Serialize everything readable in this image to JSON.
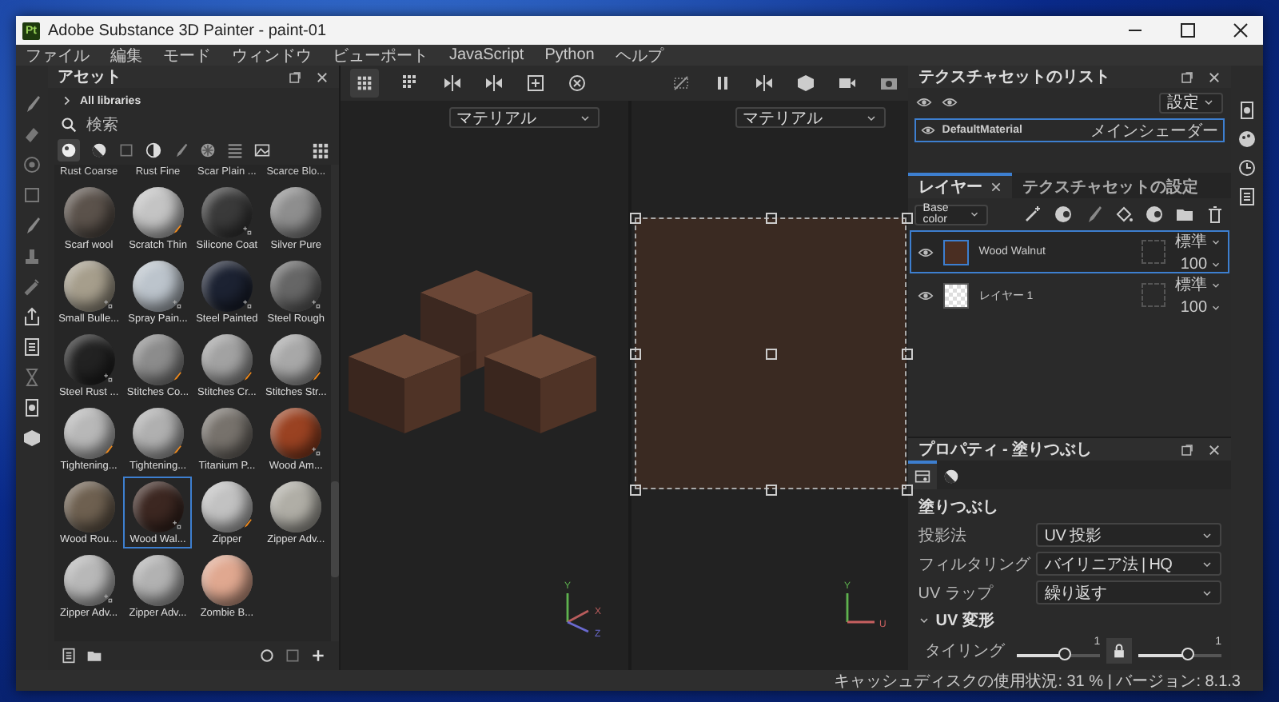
{
  "window": {
    "app_badge": "Pt",
    "title": "Adobe Substance 3D Painter - paint-01"
  },
  "menu": [
    "ファイル",
    "編集",
    "モード",
    "ウィンドウ",
    "ビューポート",
    "JavaScript",
    "Python",
    "ヘルプ"
  ],
  "assets": {
    "title": "アセット",
    "library": "All libraries",
    "search": {
      "placeholder": "検索"
    },
    "partial_labels": [
      "Rust Coarse",
      "Rust Fine",
      "Scar Plain ...",
      "Scarce Blo..."
    ],
    "items": [
      {
        "name": "Scarf wool",
        "color": "#5b524b",
        "kind": "material",
        "selected": false
      },
      {
        "name": "Scratch Thin",
        "color": "#c4c4c4",
        "kind": "brush",
        "selected": false
      },
      {
        "name": "Silicone Coat",
        "color": "#3a3a3a",
        "kind": "preset",
        "selected": false
      },
      {
        "name": "Silver Pure",
        "color": "#8e8e8e",
        "kind": "material",
        "selected": false
      },
      {
        "name": "Small Bulle...",
        "color": "#a69e8c",
        "kind": "preset",
        "selected": false
      },
      {
        "name": "Spray Pain...",
        "color": "#bcc4cc",
        "kind": "preset",
        "selected": false
      },
      {
        "name": "Steel Painted",
        "color": "#1c2232",
        "kind": "preset",
        "selected": false
      },
      {
        "name": "Steel Rough",
        "color": "#666666",
        "kind": "preset",
        "selected": false
      },
      {
        "name": "Steel Rust ...",
        "color": "#222222",
        "kind": "preset",
        "selected": false
      },
      {
        "name": "Stitches Co...",
        "color": "#8c8c8c",
        "kind": "brush",
        "selected": false
      },
      {
        "name": "Stitches Cr...",
        "color": "#a2a2a2",
        "kind": "brush",
        "selected": false
      },
      {
        "name": "Stitches Str...",
        "color": "#a8a8a8",
        "kind": "brush",
        "selected": false
      },
      {
        "name": "Tightening...",
        "color": "#b8b8b8",
        "kind": "brush",
        "selected": false
      },
      {
        "name": "Tightening...",
        "color": "#b0b0b0",
        "kind": "brush",
        "selected": false
      },
      {
        "name": "Titanium P...",
        "color": "#77726c",
        "kind": "material",
        "selected": false
      },
      {
        "name": "Wood Am...",
        "color": "#9a4222",
        "kind": "preset",
        "selected": false
      },
      {
        "name": "Wood Rou...",
        "color": "#6e6050",
        "kind": "material",
        "selected": false
      },
      {
        "name": "Wood Wal...",
        "color": "#3c2721",
        "kind": "preset",
        "selected": true
      },
      {
        "name": "Zipper",
        "color": "#c2c2c2",
        "kind": "brush",
        "selected": false
      },
      {
        "name": "Zipper Adv...",
        "color": "#b0aea6",
        "kind": "material",
        "selected": false
      },
      {
        "name": "Zipper Adv...",
        "color": "#b8b8b8",
        "kind": "preset",
        "selected": false
      },
      {
        "name": "Zipper Adv...",
        "color": "#b2b2b2",
        "kind": "material",
        "selected": false
      },
      {
        "name": "Zombie B...",
        "color": "#e0a890",
        "kind": "material",
        "selected": false
      }
    ]
  },
  "viewport": {
    "panes": [
      {
        "kind": "model",
        "channel": "マテリアル",
        "axes": [
          {
            "label": "Y",
            "color": "#5fb34f"
          },
          {
            "label": "X",
            "color": "#b85c5c"
          },
          {
            "label": "Z",
            "color": "#6a6ad0"
          }
        ]
      },
      {
        "kind": "uv",
        "channel": "マテリアル",
        "axes": [
          {
            "label": "Y",
            "color": "#5fb34f"
          },
          {
            "label": "U",
            "color": "#c76060"
          }
        ]
      }
    ]
  },
  "texture_sets": {
    "title": "テクスチャセットのリスト",
    "settings": "設定",
    "items": [
      {
        "name": "DefaultMaterial",
        "shader": "メインシェーダー",
        "selected": true
      }
    ]
  },
  "layer_tabs": [
    {
      "label": "レイヤー",
      "selected": true,
      "closable": true
    },
    {
      "label": "テクスチャセットの設定",
      "selected": false,
      "closable": false
    }
  ],
  "channel": "Base color",
  "layers": [
    {
      "name": "Wood Walnut",
      "kind": "fill",
      "blend": "標準",
      "opacity": "100",
      "selected": true
    },
    {
      "name": "レイヤー 1",
      "kind": "paint",
      "blend": "標準",
      "opacity": "100",
      "selected": false
    }
  ],
  "properties": {
    "title": "プロパティ - 塗りつぶし",
    "tabs": [
      {
        "selected": true
      },
      {
        "selected": false
      }
    ],
    "section": "塗りつぶし",
    "fields": [
      {
        "label": "投影法",
        "value": "UV 投影"
      },
      {
        "label": "フィルタリング",
        "value": "バイリニア法 | HQ"
      },
      {
        "label": "UV ラップ",
        "value": "繰り返す"
      }
    ],
    "group": {
      "label": "UV 変形",
      "expanded": true
    },
    "tiling": {
      "label": "タイリング",
      "locked": true,
      "sliders": [
        {
          "reading": "1",
          "level": 0.57
        },
        {
          "reading": "1",
          "level": 0.6
        }
      ]
    }
  },
  "status": "キャッシュディスクの使用状況:  31 % | バージョン: 8.1.3"
}
